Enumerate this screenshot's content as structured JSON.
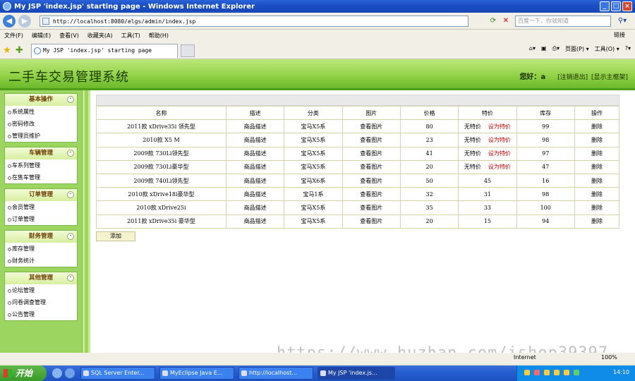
{
  "browser": {
    "window_title": "My JSP 'index.jsp' starting page - Windows Internet Explorer",
    "address": "http://localhost:8080/elgs/admin/index.jsp",
    "search_placeholder": "百度一下，你就知道",
    "menu": [
      "文件(F)",
      "编辑(E)",
      "查看(V)",
      "收藏夹(A)",
      "工具(T)",
      "帮助(H)"
    ],
    "menu_right": "链接",
    "tab_title": "My JSP 'index.jsp' starting page",
    "cmd_page": "页面(P) ▾",
    "cmd_tools": "工具(O) ▾"
  },
  "header": {
    "system_title": "二手车交易管理系统",
    "greeting": "您好：",
    "username": "a",
    "logout": "[注销退出]",
    "show_frame": "[显示主框架]"
  },
  "sidebar": {
    "groups": [
      {
        "title": "基本操作",
        "items": [
          "系统属性",
          "密码修改",
          "管理员维护"
        ]
      },
      {
        "title": "车辆管理",
        "items": [
          "车系列管理",
          "在售车管理"
        ]
      },
      {
        "title": "订单管理",
        "items": [
          "会员管理",
          "订单管理"
        ]
      },
      {
        "title": "财务管理",
        "items": [
          "库存管理",
          "财务统计"
        ]
      },
      {
        "title": "其他管理",
        "items": [
          "论坛管理",
          "问卷调查管理",
          "公告管理"
        ]
      }
    ]
  },
  "table": {
    "headers": [
      "名称",
      "描述",
      "分类",
      "图片",
      "价格",
      "特价",
      "库存",
      "操作"
    ],
    "rows": [
      {
        "name": "2011款 xDrive35i 领先型",
        "desc": "商品描述",
        "category": "宝马X5系",
        "image": "查看图片",
        "price": "80",
        "special_text": "无特价",
        "special_link": "设为特价",
        "stock": "99",
        "action": "删除"
      },
      {
        "name": "2010款 X5 M",
        "desc": "商品描述",
        "category": "宝马X5系",
        "image": "查看图片",
        "price": "23",
        "special_text": "无特价",
        "special_link": "设为特价",
        "stock": "98",
        "action": "删除"
      },
      {
        "name": "2009款 730Li领先型",
        "desc": "商品描述",
        "category": "宝马X5系",
        "image": "查看图片",
        "price": "41",
        "special_text": "无特价",
        "special_link": "设为特价",
        "stock": "97",
        "action": "删除"
      },
      {
        "name": "2009款 730Li豪华型",
        "desc": "商品描述",
        "category": "宝马X5系",
        "image": "查看图片",
        "price": "20",
        "special_text": "无特价",
        "special_link": "设为特价",
        "stock": "47",
        "action": "删除"
      },
      {
        "name": "2009款 740Li领先型",
        "desc": "商品描述",
        "category": "宝马X6系",
        "image": "查看图片",
        "price": "50",
        "special_value": "45",
        "stock": "16",
        "action": "删除"
      },
      {
        "name": "2010款 xDrive18i豪华型",
        "desc": "商品描述",
        "category": "宝马1系",
        "image": "查看图片",
        "price": "32",
        "special_value": "31",
        "stock": "98",
        "action": "删除"
      },
      {
        "name": "2010款 xDrive25i",
        "desc": "商品描述",
        "category": "宝马X5系",
        "image": "查看图片",
        "price": "35",
        "special_value": "33",
        "stock": "100",
        "action": "删除"
      },
      {
        "name": "2011款 xDrive35i 豪华型",
        "desc": "商品描述",
        "category": "宝马X5系",
        "image": "查看图片",
        "price": "20",
        "special_value": "15",
        "stock": "94",
        "action": "删除"
      }
    ],
    "add_button": "添加"
  },
  "watermark": "https://www.huzhan.com/ishop39397",
  "status": {
    "zone": "Internet",
    "zoom": "100%"
  },
  "taskbar": {
    "start": "开始",
    "items": [
      "SQL Server Enter...",
      "MyEclipse Java E...",
      "http://localhost...",
      "My JSP 'index.js..."
    ],
    "time": "14:10"
  }
}
